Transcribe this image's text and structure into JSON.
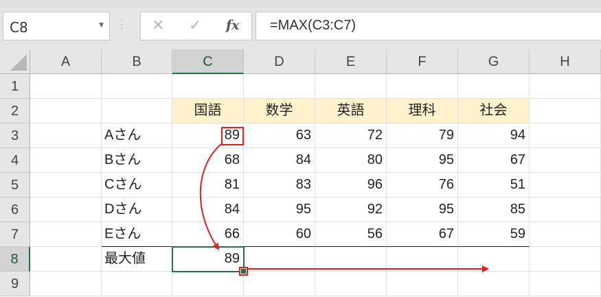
{
  "name_box": {
    "value": "C8"
  },
  "formula_bar": {
    "cancel": "✕",
    "enter": "✓",
    "fx": "fx",
    "formula": "=MAX(C3:C7)"
  },
  "columns": [
    "A",
    "B",
    "C",
    "D",
    "E",
    "F",
    "G",
    "H"
  ],
  "rows": [
    "1",
    "2",
    "3",
    "4",
    "5",
    "6",
    "7",
    "8",
    "9"
  ],
  "subjects": [
    "国語",
    "数学",
    "英語",
    "理科",
    "社会"
  ],
  "students": [
    {
      "name": "Aさん",
      "scores": [
        "89",
        "63",
        "72",
        "79",
        "94"
      ]
    },
    {
      "name": "Bさん",
      "scores": [
        "68",
        "84",
        "80",
        "95",
        "67"
      ]
    },
    {
      "name": "Cさん",
      "scores": [
        "81",
        "83",
        "96",
        "76",
        "51"
      ]
    },
    {
      "name": "Dさん",
      "scores": [
        "84",
        "95",
        "92",
        "95",
        "85"
      ]
    },
    {
      "name": "Eさん",
      "scores": [
        "66",
        "60",
        "56",
        "67",
        "59"
      ]
    }
  ],
  "max_row": {
    "label": "最大値",
    "value": "89"
  },
  "colors": {
    "header_fill": "#fff2cc",
    "selection": "#217346",
    "annotation": "#e02020"
  }
}
